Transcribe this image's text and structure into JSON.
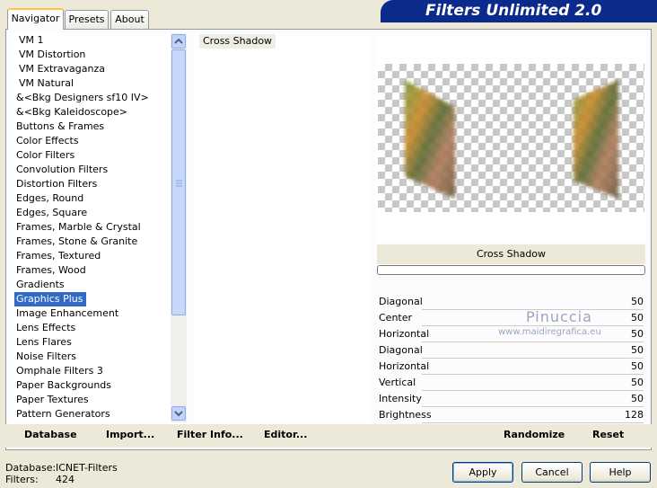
{
  "tabs": [
    {
      "label": "Navigator",
      "active": true
    },
    {
      "label": "Presets",
      "active": false
    },
    {
      "label": "About",
      "active": false
    }
  ],
  "banner": {
    "title": "Filters Unlimited 2.0"
  },
  "filter_list": {
    "selected": "Graphics Plus",
    "items": [
      "VM 1",
      "VM Distortion",
      "VM Extravaganza",
      "VM Natural",
      "&<Bkg Designers sf10 IV>",
      "&<Bkg Kaleidoscope>",
      "Buttons & Frames",
      "Color Effects",
      "Color Filters",
      "Convolution Filters",
      "Distortion Filters",
      "Edges, Round",
      "Edges, Square",
      "Frames, Marble & Crystal",
      "Frames, Stone & Granite",
      "Frames, Textured",
      "Frames, Wood",
      "Gradients",
      "Graphics Plus",
      "Image Enhancement",
      "Lens Effects",
      "Lens Flares",
      "Noise Filters",
      "Omphale Filters 3",
      "Paper Backgrounds",
      "Paper Textures",
      "Pattern Generators"
    ]
  },
  "effect_list": {
    "items": [
      "Cross Shadow"
    ]
  },
  "effect_panel": {
    "title": "Cross Shadow"
  },
  "params": [
    {
      "label": "Diagonal",
      "value": "50"
    },
    {
      "label": "Center",
      "value": "50"
    },
    {
      "label": "Horizontal",
      "value": "50"
    },
    {
      "label": "Diagonal",
      "value": "50"
    },
    {
      "label": "Horizontal",
      "value": "50"
    },
    {
      "label": "Vertical",
      "value": "50"
    },
    {
      "label": "Intensity",
      "value": "50"
    },
    {
      "label": "Brightness",
      "value": "128"
    }
  ],
  "watermark": {
    "name": "Pinuccia",
    "url": "www.maidiregrafica.eu"
  },
  "toolbar": {
    "database": "Database",
    "import": "Import...",
    "filter_info": "Filter Info...",
    "editor": "Editor...",
    "randomize": "Randomize",
    "reset": "Reset"
  },
  "status": {
    "database_label": "Database:",
    "database_value": "ICNET-Filters",
    "filters_label": "Filters:",
    "filters_value": "424"
  },
  "buttons": {
    "apply": "Apply",
    "cancel": "Cancel",
    "help": "Help"
  },
  "colors": {
    "selection": "#316ac5",
    "banner": "#0a2a8c"
  }
}
